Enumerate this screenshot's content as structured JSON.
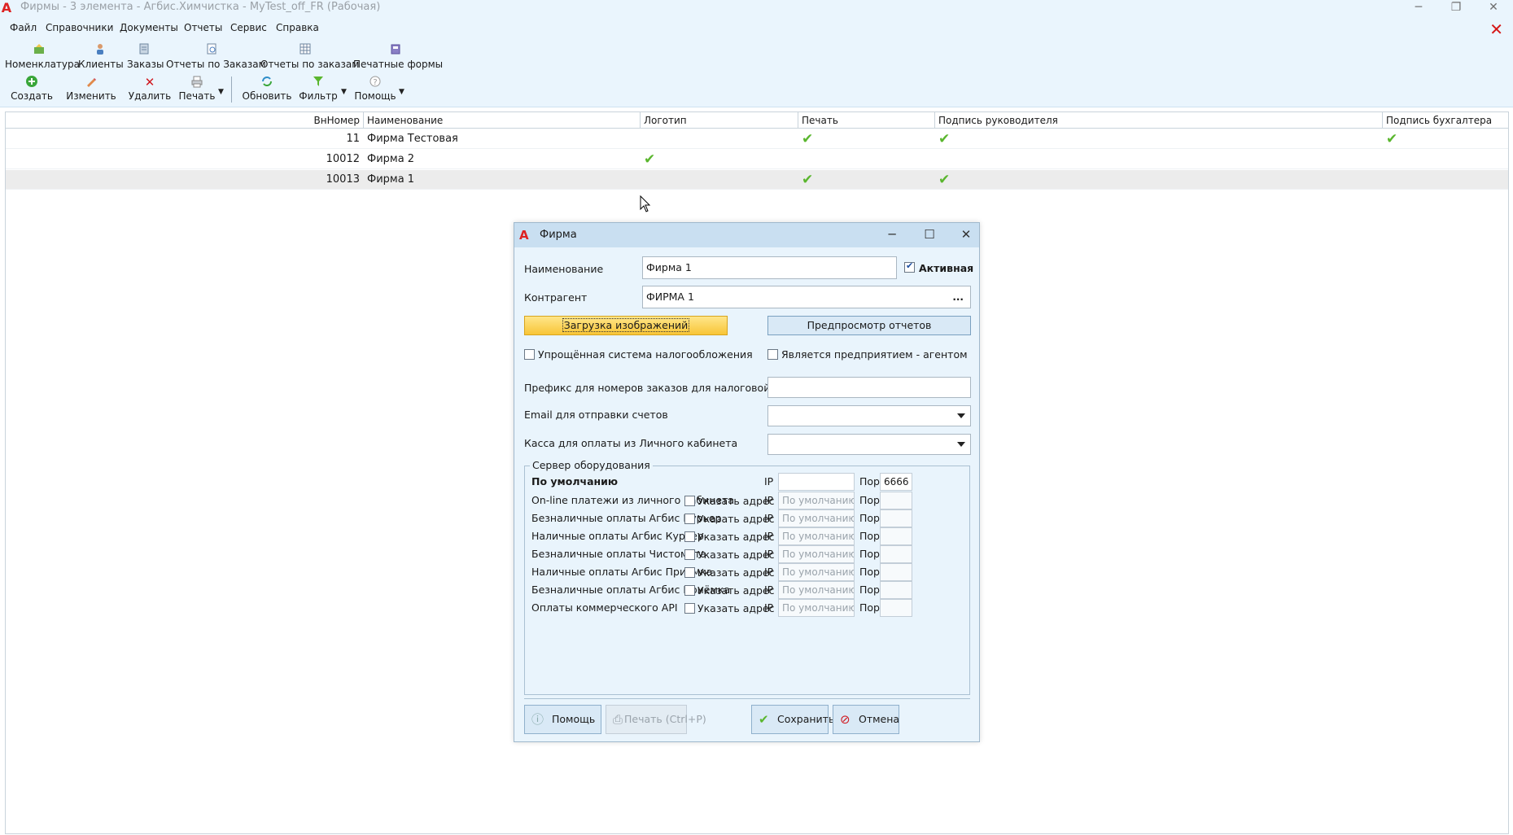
{
  "window": {
    "title": "Фирмы - 3 элемента - Агбис.Химчистка - MyTest_off_FR (Рабочая)",
    "minimize": "─",
    "maximize": "❐",
    "close": "✕"
  },
  "menu": [
    "Файл",
    "Справочники",
    "Документы",
    "Отчеты",
    "Сервис",
    "Справка"
  ],
  "doc_close": "✕",
  "nav": [
    {
      "label": "Номенклатура",
      "icon": "nomenclature-icon"
    },
    {
      "label": "Клиенты",
      "icon": "clients-icon"
    },
    {
      "label": "Заказы",
      "icon": "orders-icon"
    },
    {
      "label": "Отчеты по Заказам",
      "icon": "order-reports-icon"
    },
    {
      "label": "Отчеты по заказам",
      "icon": "order-reports-table-icon"
    },
    {
      "label": "Печатные формы",
      "icon": "print-forms-icon"
    }
  ],
  "toolbar": {
    "create": "Создать",
    "edit": "Изменить",
    "delete": "Удалить",
    "print": "Печать",
    "refresh": "Обновить",
    "filter": "Фильтр",
    "help": "Помощь"
  },
  "grid": {
    "columns": [
      "ВнНомер",
      "Наименование",
      "Логотип",
      "Печать",
      "Подпись руководителя",
      "Подпись бухгалтера"
    ],
    "rows": [
      {
        "num": "11",
        "name": "Фирма Тестовая",
        "logo": false,
        "stamp": true,
        "director_sign": true,
        "accountant_sign": true
      },
      {
        "num": "10012",
        "name": "Фирма 2",
        "logo": true,
        "stamp": false,
        "director_sign": false,
        "accountant_sign": false
      },
      {
        "num": "10013",
        "name": "Фирма 1",
        "logo": false,
        "stamp": true,
        "director_sign": true,
        "accountant_sign": false
      }
    ],
    "selected_row": 2,
    "check_glyph": "✔"
  },
  "dialog": {
    "title": "Фирма",
    "name_label": "Наименование",
    "name_value": "Фирма 1",
    "active_label": "Активная",
    "active_checked": true,
    "counterparty_label": "Контрагент",
    "counterparty_value": "ФИРМА 1",
    "counterparty_button": "...",
    "load_images": "Загрузка изображений",
    "preview_reports": "Предпросмотр отчетов",
    "simplified_tax": "Упрощённая система налогообложения",
    "simplified_tax_checked": false,
    "is_agent": "Является предприятием - агентом",
    "is_agent_checked": false,
    "prefix_label": "Префикс для номеров заказов для налоговой",
    "prefix_value": "",
    "email_label": "Email для отправки счетов",
    "email_value": "",
    "cash_label": "Касса для оплаты из Личного кабинета",
    "cash_value": "",
    "equipment": {
      "legend": "Сервер оборудования",
      "default_label": "По умолчанию",
      "ip_label": "IP",
      "port_label": "Порт",
      "default_ip": "",
      "default_port": "6666",
      "specify_label": "Указать адрес",
      "ip_placeholder": "По умолчанию",
      "rows": [
        "On-line платежи из личного кабинета",
        "Безналичные оплаты Агбис Курьер",
        "Наличные оплаты Агбис Курьер",
        "Безналичные оплаты Чистомата",
        "Наличные оплаты Агбис Приёмка",
        "Безналичные оплаты Агбис Приёмка",
        "Оплаты коммерческого API"
      ]
    },
    "help": "Помощь",
    "print": "Печать (Ctrl+P)",
    "save": "Сохранить",
    "cancel": "Отмена"
  }
}
